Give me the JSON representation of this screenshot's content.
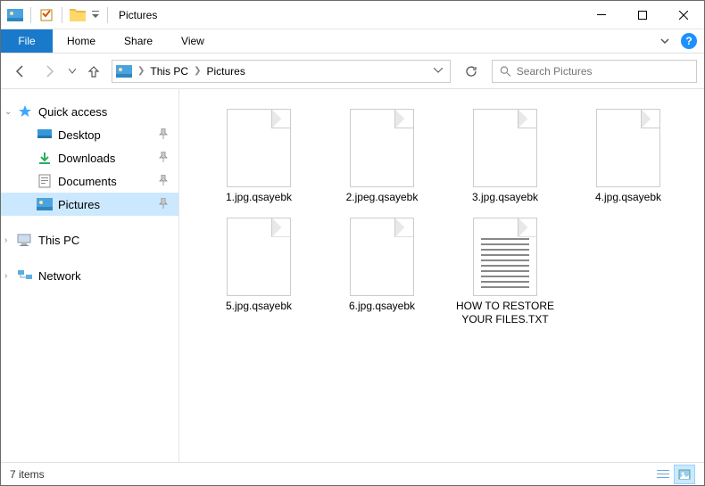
{
  "title": "Pictures",
  "menu": {
    "file": "File",
    "home": "Home",
    "share": "Share",
    "view": "View"
  },
  "breadcrumbs": [
    "This PC",
    "Pictures"
  ],
  "search_placeholder": "Search Pictures",
  "sidebar": {
    "quick_access": "Quick access",
    "items": [
      {
        "label": "Desktop",
        "icon": "desktop"
      },
      {
        "label": "Downloads",
        "icon": "downloads"
      },
      {
        "label": "Documents",
        "icon": "documents"
      },
      {
        "label": "Pictures",
        "icon": "pictures",
        "selected": true
      }
    ],
    "this_pc": "This PC",
    "network": "Network"
  },
  "files": [
    {
      "name": "1.jpg.qsayebk",
      "type": "blank"
    },
    {
      "name": "2.jpeg.qsayebk",
      "type": "blank"
    },
    {
      "name": "3.jpg.qsayebk",
      "type": "blank"
    },
    {
      "name": "4.jpg.qsayebk",
      "type": "blank"
    },
    {
      "name": "5.jpg.qsayebk",
      "type": "blank"
    },
    {
      "name": "6.jpg.qsayebk",
      "type": "blank"
    },
    {
      "name": "HOW TO RESTORE YOUR FILES.TXT",
      "type": "txt"
    }
  ],
  "status": "7 items"
}
